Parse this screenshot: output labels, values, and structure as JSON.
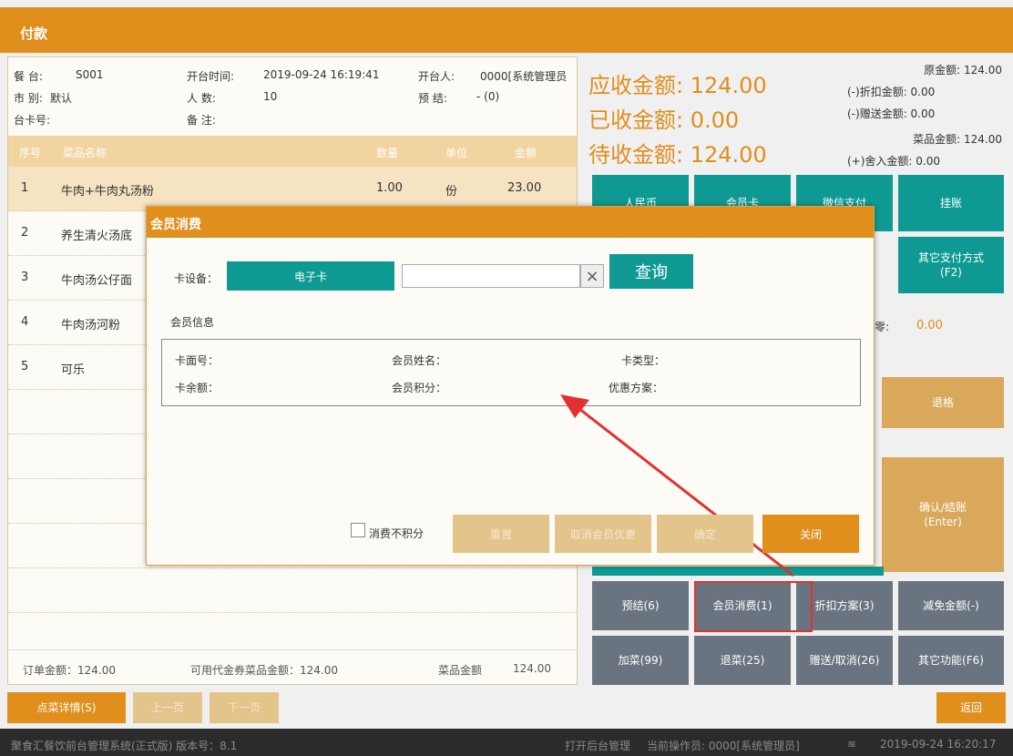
{
  "title": "付款",
  "table_info": {
    "seat_label": "餐 台:",
    "seat": "S001",
    "open_time_label": "开台时间:",
    "open_time": "2019-09-24 16:19:41",
    "opener_label": "开台人:",
    "opener": "0000[系统管理员",
    "market_label": "市 别:",
    "market": "默认",
    "people_label": "人  数:",
    "people": "10",
    "prepay_label": "预 结:",
    "prepay": "- (0)",
    "card_label": "台卡号:",
    "note_label": "备  注:"
  },
  "columns": [
    "序号",
    "菜品名称",
    "数量",
    "单位",
    "金额"
  ],
  "items": [
    {
      "no": "1",
      "name": "牛肉+牛肉丸汤粉",
      "qty": "1.00",
      "unit": "份",
      "amount": "23.00"
    },
    {
      "no": "2",
      "name": "养生清火汤底"
    },
    {
      "no": "3",
      "name": "牛肉汤公仔面"
    },
    {
      "no": "4",
      "name": "牛肉汤河粉"
    },
    {
      "no": "5",
      "name": "可乐"
    }
  ],
  "footer": {
    "order_amount": "订单金额：124.00",
    "voucher_amount": "可用代金券菜品金额：124.00",
    "dish_label": "菜品金额",
    "dish_amount": "124.00"
  },
  "amounts": {
    "receivable": "应收金额: 124.00",
    "received": "已收金额: 0.00",
    "pending": "待收金额: 124.00",
    "original": "原金额: 124.00",
    "discount": "(-)折扣金额: 0.00",
    "gift": "(-)赠送金额: 0.00",
    "dish": "菜品金额: 124.00",
    "round": "(+)舍入金额: 0.00"
  },
  "pay_buttons": {
    "cash": "人民币",
    "member_card": "会员卡",
    "wechat": "微信支付",
    "credit": "挂账",
    "other_pay": "其它支付方式\n(F2)"
  },
  "change_label": "零:",
  "change_value": "0.00",
  "refund_button": "退格",
  "confirm_button": "确认/结账\n(Enter)",
  "func_buttons": [
    "预结(6)",
    "会员消费(1)",
    "折扣方案(3)",
    "减免金额(-)",
    "加菜(99)",
    "退菜(25)",
    "赠送/取消(26)",
    "其它功能(F6)"
  ],
  "bottom": {
    "detail": "点菜详情(S)",
    "prev": "上一页",
    "next": "下一页",
    "back": "返回"
  },
  "status": {
    "system": "聚食汇餐饮前台管理系统(正式版) 版本号：8.1",
    "backend": "打开后台管理",
    "operator": "当前操作员: 0000[系统管理员]",
    "time": "2019-09-24 16:20:17"
  },
  "dialog": {
    "title": "会员消费",
    "device_label": "卡设备：",
    "device_value": "电子卡",
    "card_input": "",
    "clear": "×",
    "query": "查询",
    "info_title": "会员信息",
    "card_no": "卡面号：",
    "member_name": "会员姓名：",
    "card_type": "卡类型：",
    "balance": "卡余额：",
    "points": "会员积分：",
    "offer": "优惠方案：",
    "no_points": "消费不积分",
    "reset": "重置",
    "cancel_offer": "取消会员优惠",
    "confirm": "确定",
    "close": "关闭"
  }
}
